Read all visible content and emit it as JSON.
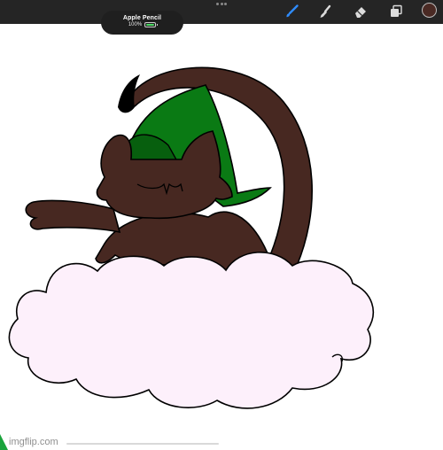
{
  "toolbar": {
    "pencil_status": {
      "title": "Apple Pencil",
      "battery_text": "100%",
      "battery_level": 1.0
    },
    "tools": [
      {
        "name": "brush",
        "icon": "brush-icon",
        "active": true
      },
      {
        "name": "smudge",
        "icon": "smudge-icon",
        "active": false
      },
      {
        "name": "eraser",
        "icon": "eraser-icon",
        "active": false
      },
      {
        "name": "layers",
        "icon": "layers-icon",
        "active": false
      }
    ],
    "current_color": "#4a2a24"
  },
  "canvas": {
    "artwork": "cat-in-witch-hat-on-cloud",
    "colors": {
      "fur": "#472821",
      "hat": "#0a7a14",
      "hat_band": "#075f0e",
      "cloud": "#fdf0fb",
      "outline": "#000000"
    }
  },
  "watermark": {
    "text": "imgflip.com"
  }
}
